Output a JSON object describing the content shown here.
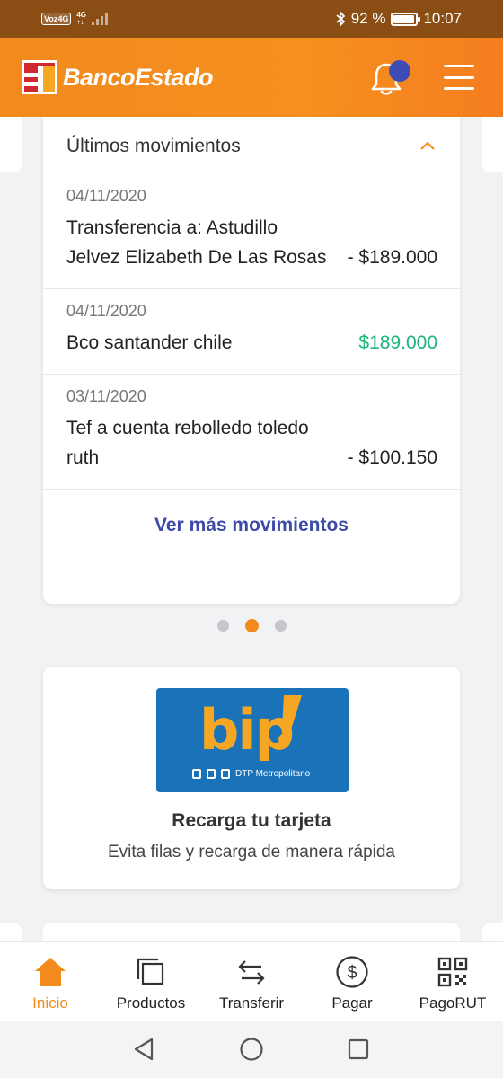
{
  "status_bar": {
    "carrier": "Voz4G",
    "network": "4G",
    "bluetooth_icon": "bluetooth-icon",
    "battery": "92 %",
    "battery_level": 0.92,
    "time": "10:07"
  },
  "header": {
    "brand": "BancoEstado",
    "notification_icon": "bell-icon",
    "menu_icon": "hamburger-icon"
  },
  "movements": {
    "title": "Últimos movimientos",
    "items": [
      {
        "date": "04/11/2020",
        "description": "Transferencia a: Astudillo Jelvez Elizabeth De Las Rosas",
        "amount": "- $189.000",
        "type": "debit"
      },
      {
        "date": "04/11/2020",
        "description": "Bco santander chile",
        "amount": "$189.000",
        "type": "credit"
      },
      {
        "date": "03/11/2020",
        "description": "Tef a cuenta rebolledo toledo ruth",
        "amount": "- $100.150",
        "type": "debit"
      }
    ],
    "more_link": "Ver más movimientos"
  },
  "carousel": {
    "pages": 3,
    "active_index": 1
  },
  "bip": {
    "logo_text": "bip",
    "logo_excl": "!",
    "logo_caption": "DTP Metropolitano",
    "title": "Recarga tu tarjeta",
    "subtitle": "Evita filas y recarga de manera rápida"
  },
  "bottom_nav": [
    {
      "label": "Inicio",
      "icon": "home-icon",
      "active": true
    },
    {
      "label": "Productos",
      "icon": "cards-icon",
      "active": false
    },
    {
      "label": "Transferir",
      "icon": "transfer-arrows-icon",
      "active": false
    },
    {
      "label": "Pagar",
      "icon": "dollar-icon",
      "active": false
    },
    {
      "label": "PagoRUT",
      "icon": "qr-code-icon",
      "active": false
    }
  ],
  "colors": {
    "brand_orange": "#f28a1e",
    "link_blue": "#3d4aa8",
    "credit_green": "#1fb47a"
  }
}
